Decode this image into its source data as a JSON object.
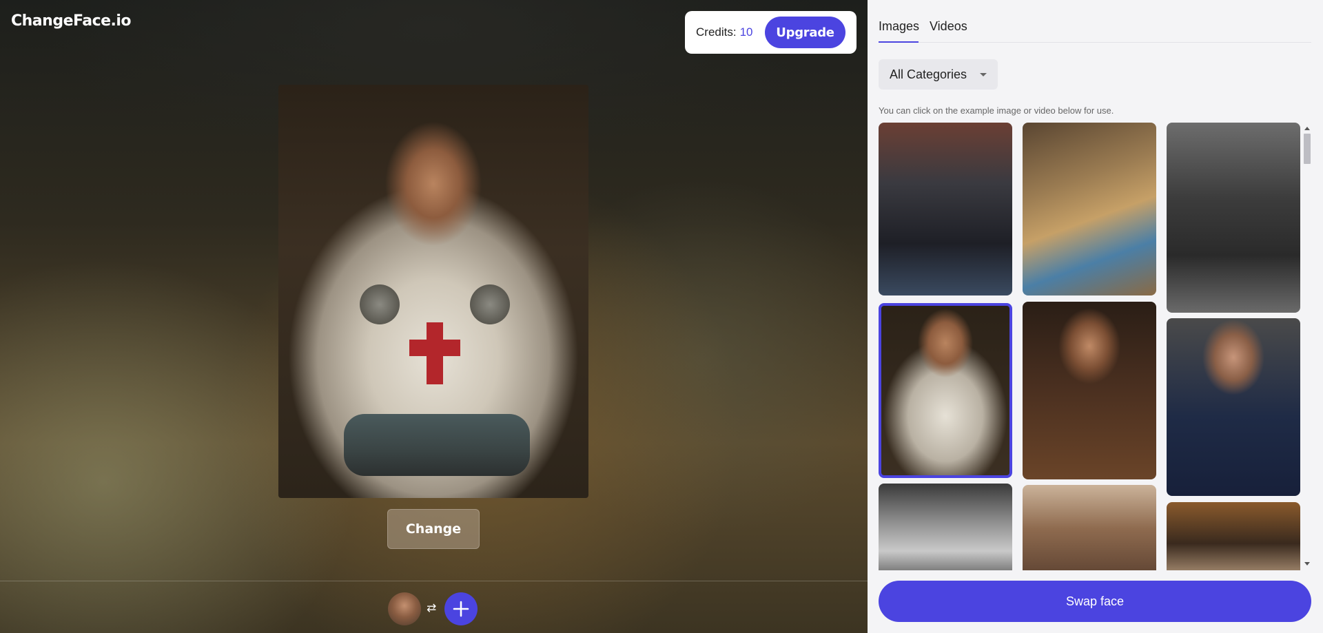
{
  "app": {
    "logo_text": "ChangeFace.io"
  },
  "credits": {
    "label": "Credits:",
    "value": "10",
    "upgrade_label": "Upgrade"
  },
  "stage": {
    "change_label": "Change",
    "swap_icon": "⇄"
  },
  "panel": {
    "tabs": [
      {
        "label": "Images",
        "active": true
      },
      {
        "label": "Videos",
        "active": false
      }
    ],
    "category_select": {
      "value": "All Categories"
    },
    "hint": "You can click on the example image or video below for use.",
    "swap_button_label": "Swap face"
  },
  "colors": {
    "accent": "#4b44e0"
  }
}
